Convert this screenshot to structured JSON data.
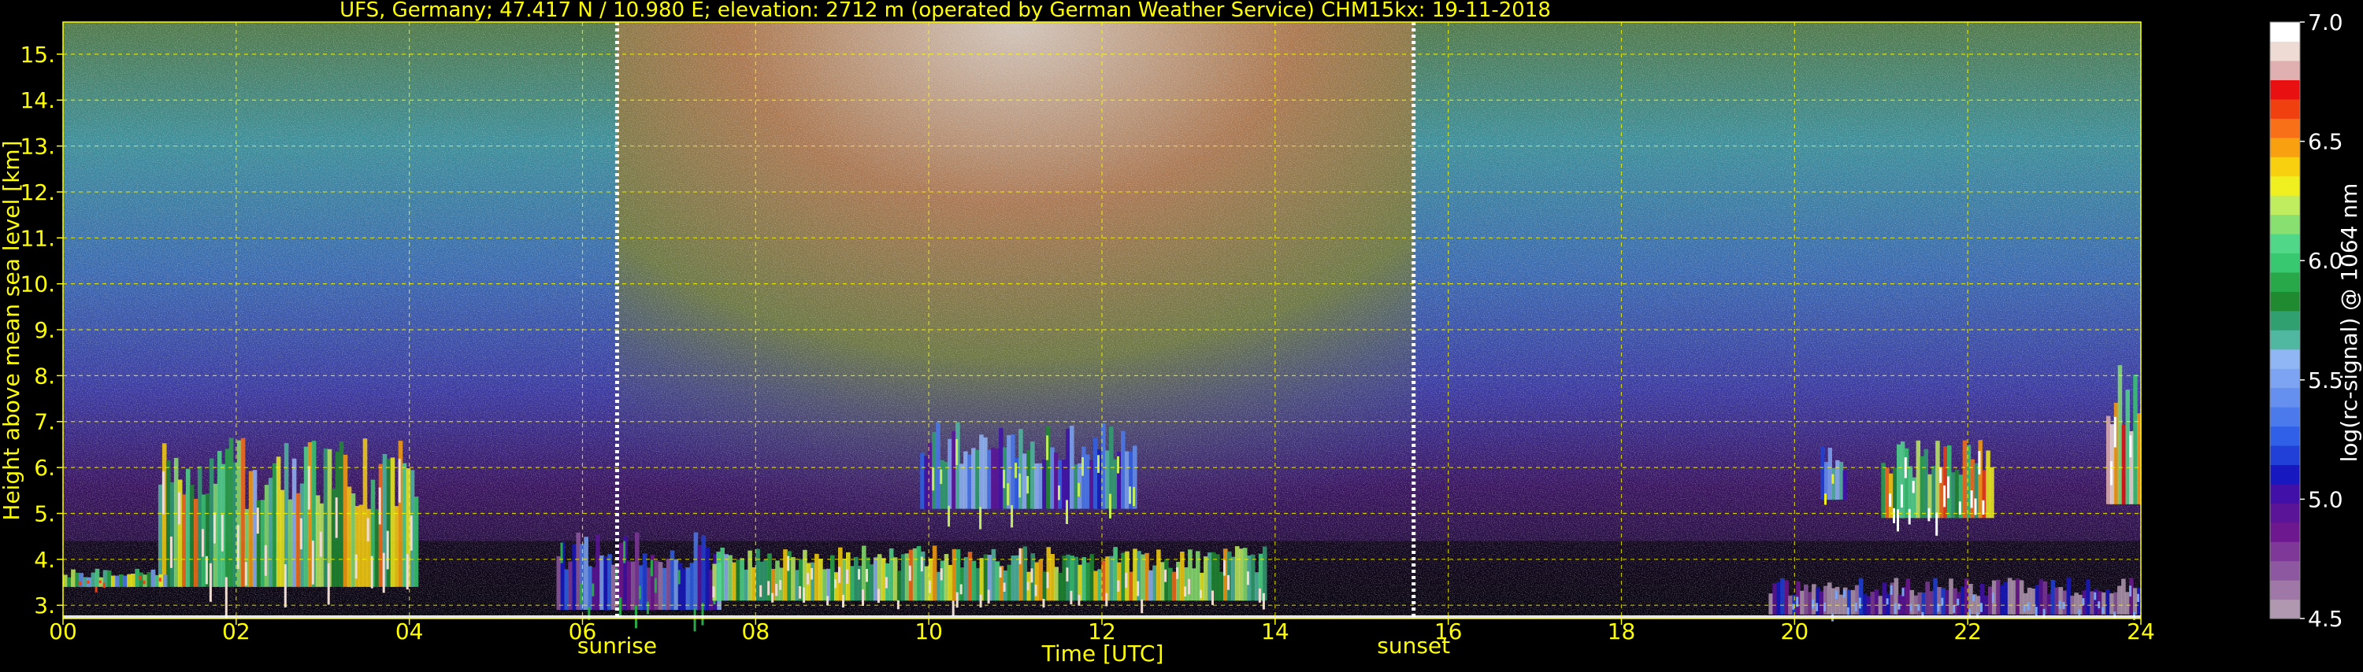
{
  "chart_data": {
    "type": "heatmap",
    "title": "UFS, Germany; 47.417 N / 10.980 E; elevation: 2712 m  (operated by German Weather Service)    CHM15kx: 19-11-2018",
    "xlabel": "Time [UTC]",
    "ylabel": "Height above mean sea level [km]",
    "xlim": [
      0,
      24
    ],
    "ylim": [
      2.712,
      15.7
    ],
    "x_ticks": [
      0,
      2,
      4,
      6,
      8,
      10,
      12,
      14,
      16,
      18,
      20,
      22,
      24
    ],
    "x_tick_labels": [
      "00",
      "02",
      "04",
      "06",
      "08",
      "10",
      "12",
      "14",
      "16",
      "18",
      "20",
      "22",
      "24"
    ],
    "y_ticks": [
      3,
      4,
      5,
      6,
      7,
      8,
      9,
      10,
      11,
      12,
      13,
      14,
      15
    ],
    "y_tick_labels": [
      "3.",
      "4.",
      "5.",
      "6.",
      "7.",
      "8.",
      "9.",
      "10.",
      "11.",
      "12.",
      "13.",
      "14.",
      "15."
    ],
    "grid": true,
    "events": [
      {
        "label": "sunrise",
        "time": 6.4
      },
      {
        "label": "sunset",
        "time": 15.6
      }
    ],
    "colorbar": {
      "label": "log(rc-signal) @ 1064 nm",
      "range": [
        4.5,
        7.0
      ],
      "ticks": [
        4.5,
        5.0,
        5.5,
        6.0,
        6.5,
        7.0
      ],
      "tick_labels": [
        "4.5",
        "5.0",
        "5.5",
        "6.0",
        "6.5",
        "7.0"
      ],
      "colors": [
        "#b098b0",
        "#a078a8",
        "#8e58a0",
        "#7e3898",
        "#6e1890",
        "#5a1498",
        "#4010a8",
        "#1818c0",
        "#2040d8",
        "#3060e8",
        "#4a7aec",
        "#6590f0",
        "#7ca4f2",
        "#90b6f4",
        "#50b8a0",
        "#30a070",
        "#1f8a30",
        "#28a848",
        "#38c870",
        "#50d888",
        "#88e070",
        "#c0ec60",
        "#f0f020",
        "#f8d010",
        "#f8a010",
        "#f87018",
        "#f04010",
        "#e81010",
        "#e0b0b0",
        "#eedcd4",
        "#ffffff"
      ]
    },
    "background_structures": [
      {
        "label": "daytime solar background",
        "start": 6.4,
        "end": 15.6,
        "min_km": 6.5,
        "max_km": 15.7,
        "level": 6.7
      },
      {
        "label": "nighttime noise upper",
        "start": 0,
        "end": 24,
        "min_km": 9,
        "max_km": 15.7,
        "level": 5.8
      }
    ],
    "cloud_layers": [
      {
        "start": 1.1,
        "end": 4.1,
        "base_km": 3.4,
        "top_km": 6.7,
        "level": 6.6
      },
      {
        "start": 0.0,
        "end": 1.2,
        "base_km": 3.4,
        "top_km": 3.8,
        "level": 6.3
      },
      {
        "start": 5.7,
        "end": 7.6,
        "base_km": 2.9,
        "top_km": 4.6,
        "level": 5.6
      },
      {
        "start": 7.5,
        "end": 13.9,
        "base_km": 3.1,
        "top_km": 4.3,
        "level": 6.6
      },
      {
        "start": 9.9,
        "end": 12.4,
        "base_km": 5.1,
        "top_km": 7.0,
        "level": 5.9
      },
      {
        "start": 19.7,
        "end": 24.0,
        "base_km": 2.8,
        "top_km": 3.6,
        "level": 5.2
      },
      {
        "start": 21.0,
        "end": 22.3,
        "base_km": 4.9,
        "top_km": 6.6,
        "level": 6.7
      },
      {
        "start": 23.6,
        "end": 24.0,
        "base_km": 5.2,
        "top_km": 8.3,
        "level": 6.9
      },
      {
        "start": 20.3,
        "end": 20.6,
        "base_km": 5.3,
        "top_km": 6.5,
        "level": 6.0
      }
    ]
  }
}
